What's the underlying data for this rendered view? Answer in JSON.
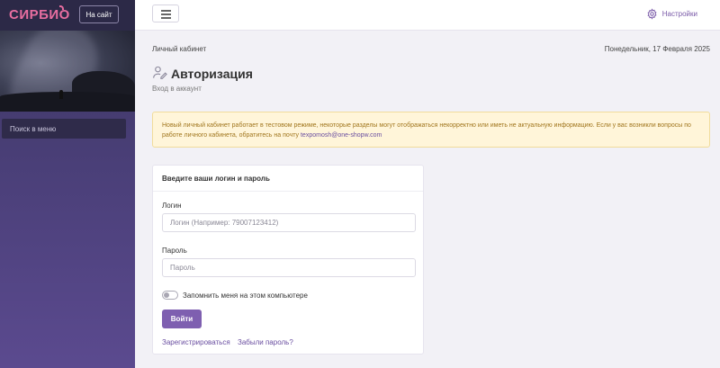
{
  "sidebar": {
    "logo": "СИРБИО",
    "site_button": "На сайт",
    "search_placeholder": "Поиск в меню"
  },
  "topbar": {
    "settings_label": "Настройки"
  },
  "page": {
    "breadcrumb": "Личный кабинет",
    "date": "Понедельник, 17 Февраля 2025",
    "title": "Авторизация",
    "subtitle": "Вход в аккаунт"
  },
  "alert": {
    "text": "Новый личный кабинет работает в тестовом режиме, некоторые разделы могут отображаться некорректно или иметь не актуальную информацию. Если у вас возникли вопросы по работе личного кабинета, обратитесь на почту ",
    "email": "texpomosh@one-shopw.com"
  },
  "login_form": {
    "heading": "Введите ваши логин и пароль",
    "login_label": "Логин",
    "login_placeholder": "Логин (Например: 79007123412)",
    "password_label": "Пароль",
    "password_placeholder": "Пароль",
    "remember_label": "Запомнить меня на этом компьютере",
    "submit_label": "Войти",
    "register_link": "Зарегистрироваться",
    "forgot_link": "Забыли пароль?"
  },
  "colors": {
    "accent": "#7e5fb0",
    "logo": "#e86ea0",
    "alert_bg": "#fff5d9",
    "alert_text": "#a0751c"
  }
}
